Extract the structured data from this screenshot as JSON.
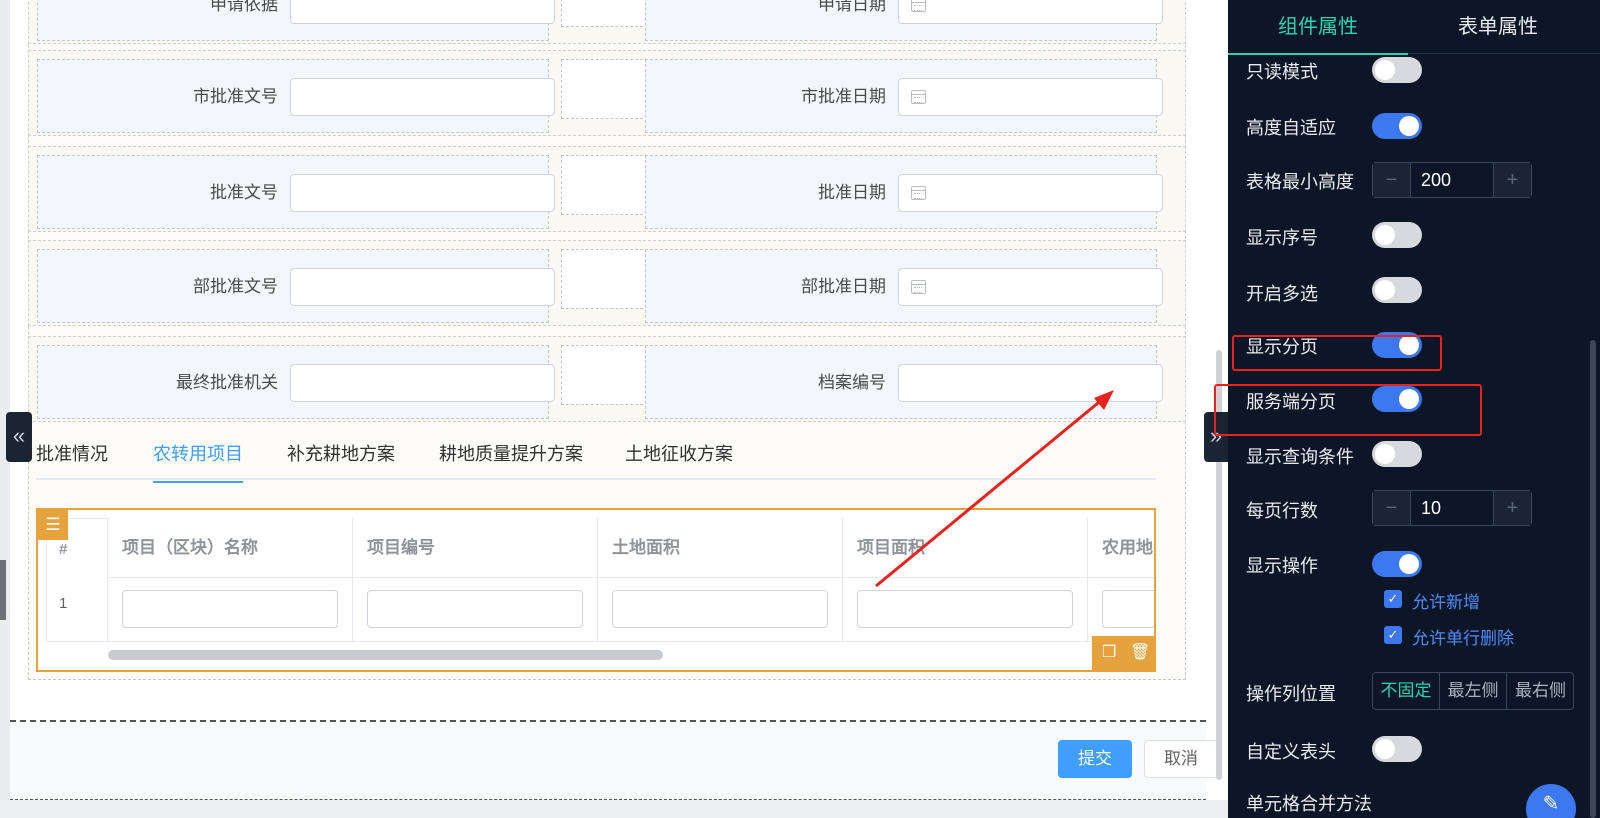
{
  "form": {
    "rows": [
      {
        "left_label": "申请依据",
        "right_label": "申请日期",
        "right_is_date": true
      },
      {
        "left_label": "市批准文号",
        "right_label": "市批准日期",
        "right_is_date": true
      },
      {
        "left_label": "批准文号",
        "right_label": "批准日期",
        "right_is_date": true
      },
      {
        "left_label": "部批准文号",
        "right_label": "部批准日期",
        "right_is_date": true
      },
      {
        "left_label": "最终批准机关",
        "right_label": "档案编号",
        "right_is_date": false
      }
    ]
  },
  "tabs": [
    {
      "label": "批准情况",
      "active": false
    },
    {
      "label": "农转用项目",
      "active": true
    },
    {
      "label": "补充耕地方案",
      "active": false
    },
    {
      "label": "耕地质量提升方案",
      "active": false
    },
    {
      "label": "土地征收方案",
      "active": false
    }
  ],
  "table": {
    "index_header": "#",
    "columns": [
      "项目（区块）名称",
      "项目编号",
      "土地面积",
      "项目面积",
      "农用地"
    ],
    "rows": [
      {
        "index": "1"
      }
    ]
  },
  "footer": {
    "submit_label": "提交",
    "cancel_label": "取消"
  },
  "panel": {
    "tabs": [
      {
        "label": "组件属性",
        "active": true
      },
      {
        "label": "表单属性",
        "active": false
      }
    ],
    "readonly_label": "只读模式",
    "readonly_on": false,
    "auto_height_label": "高度自适应",
    "auto_height_on": true,
    "min_height_label": "表格最小高度",
    "min_height_value": "200",
    "show_index_label": "显示序号",
    "show_index_on": false,
    "multi_select_label": "开启多选",
    "multi_select_on": false,
    "show_pagination_label": "显示分页",
    "show_pagination_on": true,
    "server_pagination_label": "服务端分页",
    "server_pagination_on": true,
    "show_query_label": "显示查询条件",
    "show_query_on": false,
    "page_size_label": "每页行数",
    "page_size_value": "10",
    "show_actions_label": "显示操作",
    "show_actions_on": true,
    "allow_add_label": "允许新增",
    "allow_add_checked": true,
    "allow_delete_label": "允许单行删除",
    "allow_delete_checked": true,
    "action_col_pos_label": "操作列位置",
    "action_col_options": [
      "不固定",
      "最左侧",
      "最右侧"
    ],
    "action_col_selected": "不固定",
    "custom_header_label": "自定义表头",
    "custom_header_on": false,
    "cell_merge_label": "单元格合并方法"
  },
  "colors": {
    "accent": "#26d6b0",
    "primary": "#409eff",
    "warning": "#e6a23c",
    "annotation": "#e8231e"
  },
  "icons": [
    "calendar-icon",
    "settings-sliders-icon",
    "copy-icon",
    "trash-icon",
    "double-chevron-left-icon",
    "double-chevron-right-icon",
    "pencil-icon"
  ]
}
